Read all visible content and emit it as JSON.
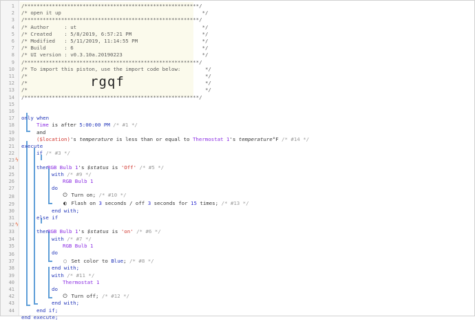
{
  "header": {
    "l1": "/*********************************************************/",
    "l2": "/* open it up                                              */",
    "l3": "/*********************************************************/",
    "l4": "/* Author     : ut                                         */",
    "l5": "/* Created    : 5/8/2019, 6:57:21 PM                       */",
    "l6": "/* Modified   : 5/11/2019, 11:14:55 PM                     */",
    "l7": "/* Build      : 6                                          */",
    "l8": "/* UI version : v0.3.10a.20190223                          */",
    "l9": "/*********************************************************/",
    "l10": "/* To import this piston, use the import code below:        */",
    "l11": "/*                                                          */",
    "l12": "/*                                                          */",
    "l13": "/*                                                          */",
    "l14": "/*********************************************************/",
    "import_code": "rgqf"
  },
  "lines": {
    "l16_kw": "only when",
    "l17_subj": "Time",
    "l17_mid": " is after ",
    "l17_val": "5:00:00 PM",
    "l17_cmt": " /* #1 */",
    "l18": "and",
    "l19_var": "($location)",
    "l19_a": "'s ",
    "l19_attr": "temperature",
    "l19_b": " is less than or equal to ",
    "l19_dev": "Thermostat 1",
    "l19_c": "'s ",
    "l19_attr2": "temperature",
    "l19_unit": "°F",
    "l19_cmt": " /* #14 */",
    "l20": "execute",
    "l21_kw": "if",
    "l21_cmt": " /* #3 */",
    "l22_dev": "RGB Bulb 1",
    "l22_a": "'s ",
    "l22_attr": "$status",
    "l22_b": " is ",
    "l22_val": "'Off'",
    "l22_cmt": " /* #5 */",
    "l23": "then",
    "l24_kw": "with",
    "l24_cmt": " /* #9 */",
    "l25_dev": "RGB Bulb 1",
    "l26": "do",
    "l27_act": "Turn on;",
    "l27_cmt": " /* #10 */",
    "l28_a": "Flash on ",
    "l28_n1": "3",
    "l28_b": " seconds / off ",
    "l28_n2": "3",
    "l28_c": " seconds for ",
    "l28_n3": "15",
    "l28_d": " times;",
    "l28_cmt": " /* #13 */",
    "l29": "end with;",
    "l30": "else if",
    "l31_dev": "RGB Bulb 1",
    "l31_a": "'s ",
    "l31_attr": "$status",
    "l31_b": " is ",
    "l31_val": "'on'",
    "l31_cmt": " /* #6 */",
    "l32": "then",
    "l33_kw": "with",
    "l33_cmt": " /* #7 */",
    "l34_dev": "RGB Bulb 1",
    "l35": "do",
    "l36_a": "Set color to ",
    "l36_val": "Blue",
    "l36_b": ";",
    "l36_cmt": " /* #8 */",
    "l37": "end with;",
    "l38_kw": "with",
    "l38_cmt": " /* #11 */",
    "l39_dev": "Thermostat 1",
    "l40": "do",
    "l41_act": "Turn off;",
    "l41_cmt": " /* #12 */",
    "l42": "end with;",
    "l43": "end if;",
    "l44": "end execute;"
  },
  "line_numbers": [
    "1",
    "2",
    "3",
    "4",
    "5",
    "6",
    "7",
    "8",
    "9",
    "10",
    "11",
    "12",
    "13",
    "14",
    "15",
    "16",
    "17",
    "18",
    "19",
    "20",
    "21",
    "22",
    "23",
    "24",
    "25",
    "26",
    "27",
    "28",
    "29",
    "30",
    "31",
    "32",
    "33",
    "34",
    "35",
    "36",
    "37",
    "38",
    "39",
    "40",
    "41",
    "42",
    "43",
    "44"
  ],
  "icons": {
    "bolt_22": "lightning-icon",
    "bolt_31": "lightning-icon",
    "power_on": "power-icon",
    "flash": "flash-toggle-icon",
    "palette": "palette-icon",
    "power_off": "power-icon"
  },
  "colors": {
    "keyword": "#1f33b8",
    "device": "#8a2be2",
    "string": "#d0342c",
    "comment": "#999999",
    "tree_line": "#5e9ed8",
    "header_bg": "#fbfaec",
    "bolt": "#e8633a"
  }
}
